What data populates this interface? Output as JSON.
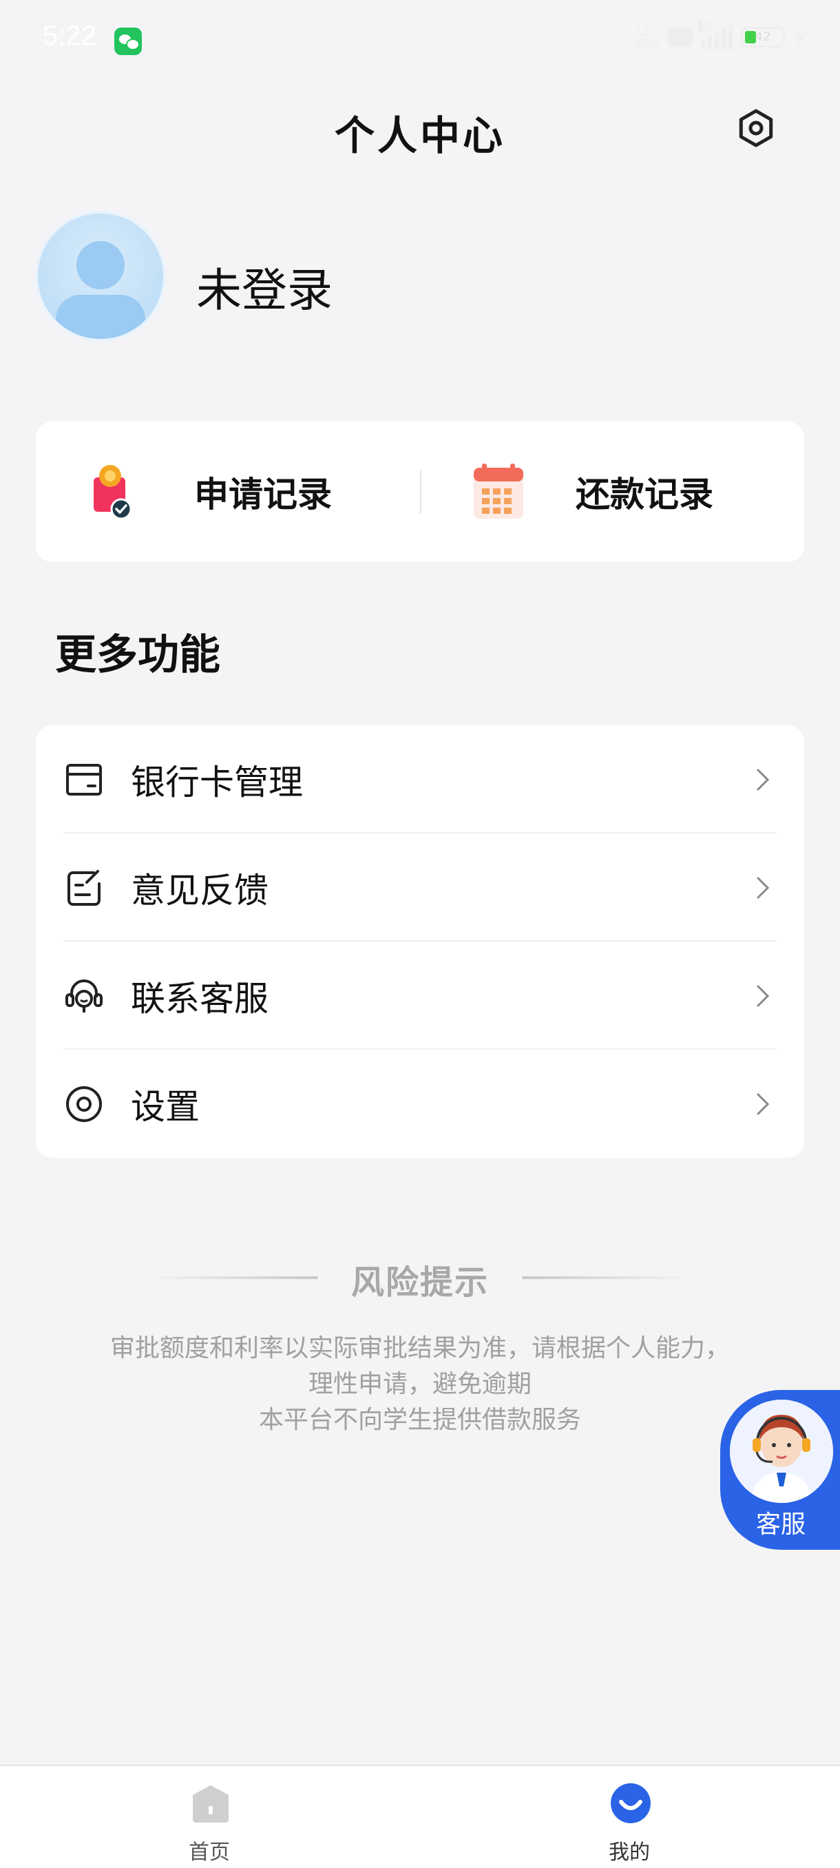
{
  "status_bar": {
    "time": "5:22",
    "speed": "12.5",
    "speed_unit": "KB/s",
    "network": "5G",
    "battery": "42"
  },
  "header": {
    "title": "个人中心",
    "settings_icon": "gear-icon"
  },
  "profile": {
    "username": "未登录"
  },
  "records": {
    "apply_label": "申请记录",
    "repay_label": "还款记录"
  },
  "more": {
    "title": "更多功能",
    "items": [
      {
        "label": "银行卡管理",
        "icon": "card-icon"
      },
      {
        "label": "意见反馈",
        "icon": "feedback-icon"
      },
      {
        "label": "联系客服",
        "icon": "headset-icon"
      },
      {
        "label": "设置",
        "icon": "settings-ring-icon"
      }
    ]
  },
  "risk": {
    "title": "风险提示",
    "line1": "审批额度和利率以实际审批结果为准，请根据个人能力，",
    "line2": "理性申请，避免逾期",
    "line3": "本平台不向学生提供借款服务"
  },
  "float_service": {
    "label": "客服"
  },
  "tabbar": {
    "home": "首页",
    "mine": "我的"
  },
  "colors": {
    "accent": "#2a63e6",
    "background": "#f4f4f6",
    "card": "#ffffff"
  }
}
